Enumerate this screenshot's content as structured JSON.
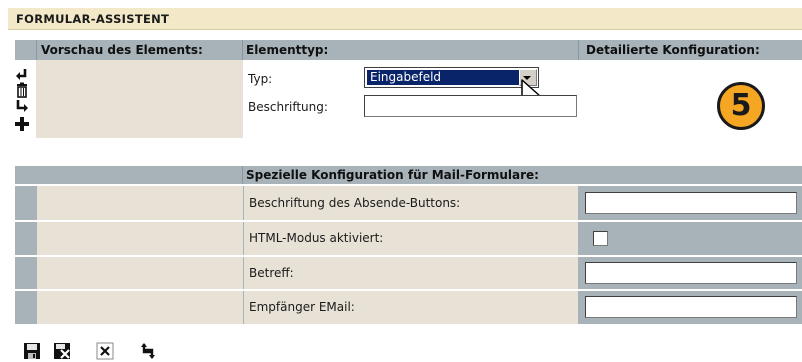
{
  "title": "FORMULAR-ASSISTENT",
  "top_header": {
    "preview": "Vorschau des Elements:",
    "type": "Elementtyp:",
    "config": "Detailierte Konfiguration:"
  },
  "type_field": {
    "label": "Typ:",
    "value": "Eingabefeld"
  },
  "caption_field": {
    "label": "Beschriftung:",
    "value": ""
  },
  "step_badge": "5",
  "mail_section": {
    "header": "Spezielle Konfiguration für Mail-Formulare:",
    "rows": [
      {
        "label": "Beschriftung des Absende-Buttons:",
        "value": ""
      },
      {
        "label": "HTML-Modus aktiviert:",
        "checked": false
      },
      {
        "label": "Betreff:",
        "value": ""
      },
      {
        "label": "Empfänger EMail:",
        "value": ""
      }
    ]
  },
  "side_icons": [
    "move-up-icon",
    "delete-icon",
    "move-down-icon",
    "add-icon"
  ],
  "toolbar": [
    "save-icon",
    "save-close-icon",
    "close-icon",
    "refresh-icon"
  ]
}
